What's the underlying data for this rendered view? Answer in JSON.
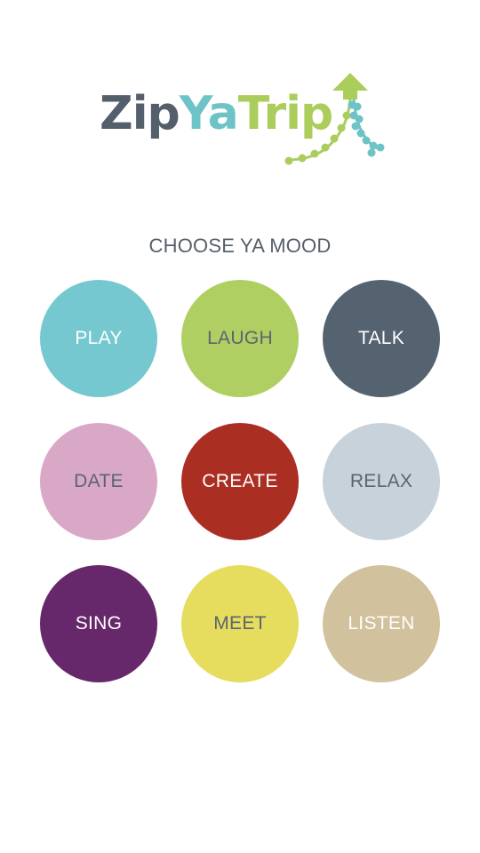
{
  "logo": {
    "part_zip": "Zip",
    "part_ya": "Ya",
    "part_trip": "Trip",
    "icon": "arrow-up-with-streamers-icon"
  },
  "heading": "CHOOSE YA MOOD",
  "moods": [
    {
      "label": "PLAY",
      "color": "#75c8cf",
      "text_color": "#ffffff"
    },
    {
      "label": "LAUGH",
      "color": "#b0cf63",
      "text_color": "#5c6470"
    },
    {
      "label": "TALK",
      "color": "#556270",
      "text_color": "#ffffff"
    },
    {
      "label": "DATE",
      "color": "#d9a8c7",
      "text_color": "#5c6470"
    },
    {
      "label": "CREATE",
      "color": "#ab2e23",
      "text_color": "#ffffff"
    },
    {
      "label": "RELAX",
      "color": "#c7d2db",
      "text_color": "#5c6470"
    },
    {
      "label": "SING",
      "color": "#66286b",
      "text_color": "#ffffff"
    },
    {
      "label": "MEET",
      "color": "#e6dc5e",
      "text_color": "#5c6470"
    },
    {
      "label": "LISTEN",
      "color": "#d2c19d",
      "text_color": "#ffffff"
    }
  ]
}
